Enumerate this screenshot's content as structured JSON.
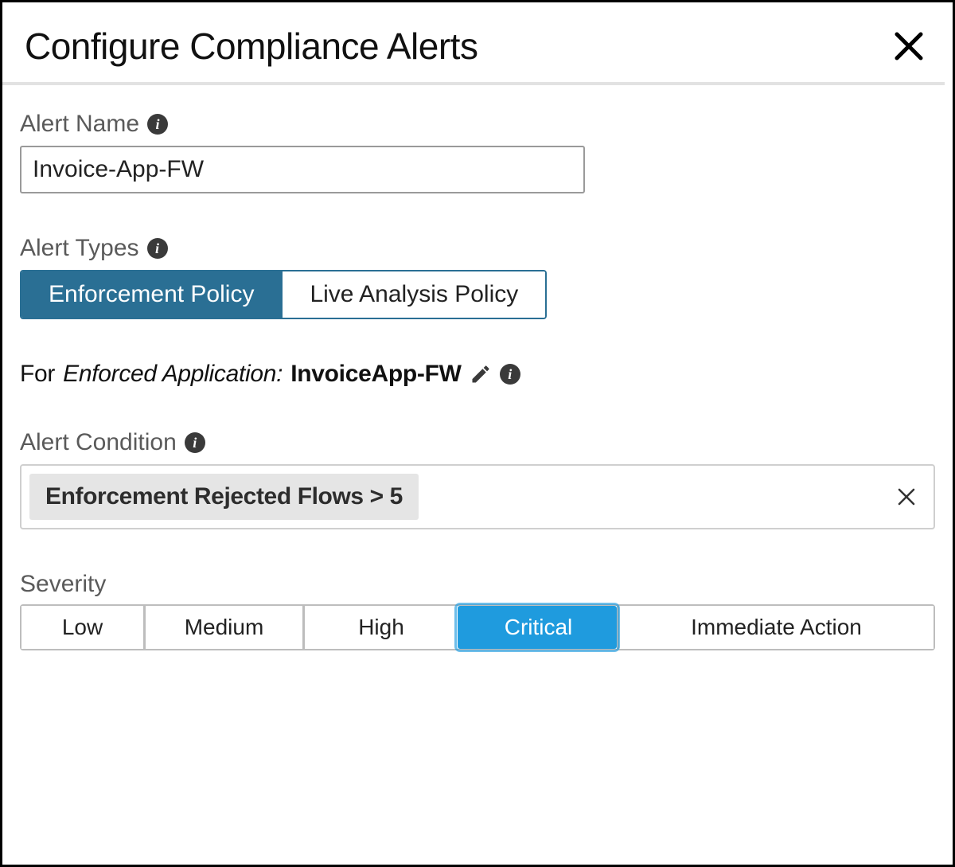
{
  "dialog": {
    "title": "Configure Compliance Alerts"
  },
  "alertName": {
    "label": "Alert Name",
    "value": "Invoice-App-FW"
  },
  "alertTypes": {
    "label": "Alert Types",
    "options": [
      {
        "id": "enforcement",
        "label": "Enforcement Policy",
        "active": true
      },
      {
        "id": "liveanalysis",
        "label": "Live Analysis Policy",
        "active": false
      }
    ]
  },
  "enforcedApp": {
    "prefix": "For",
    "label": "Enforced Application:",
    "value": "InvoiceApp-FW"
  },
  "alertCondition": {
    "label": "Alert Condition",
    "chip": "Enforcement Rejected Flows  >  5"
  },
  "severity": {
    "label": "Severity",
    "options": [
      {
        "id": "low",
        "label": "Low",
        "active": false
      },
      {
        "id": "medium",
        "label": "Medium",
        "active": false
      },
      {
        "id": "high",
        "label": "High",
        "active": false
      },
      {
        "id": "critical",
        "label": "Critical",
        "active": true
      },
      {
        "id": "immediate",
        "label": "Immediate Action",
        "active": false
      }
    ]
  },
  "icons": {
    "info": "i"
  }
}
